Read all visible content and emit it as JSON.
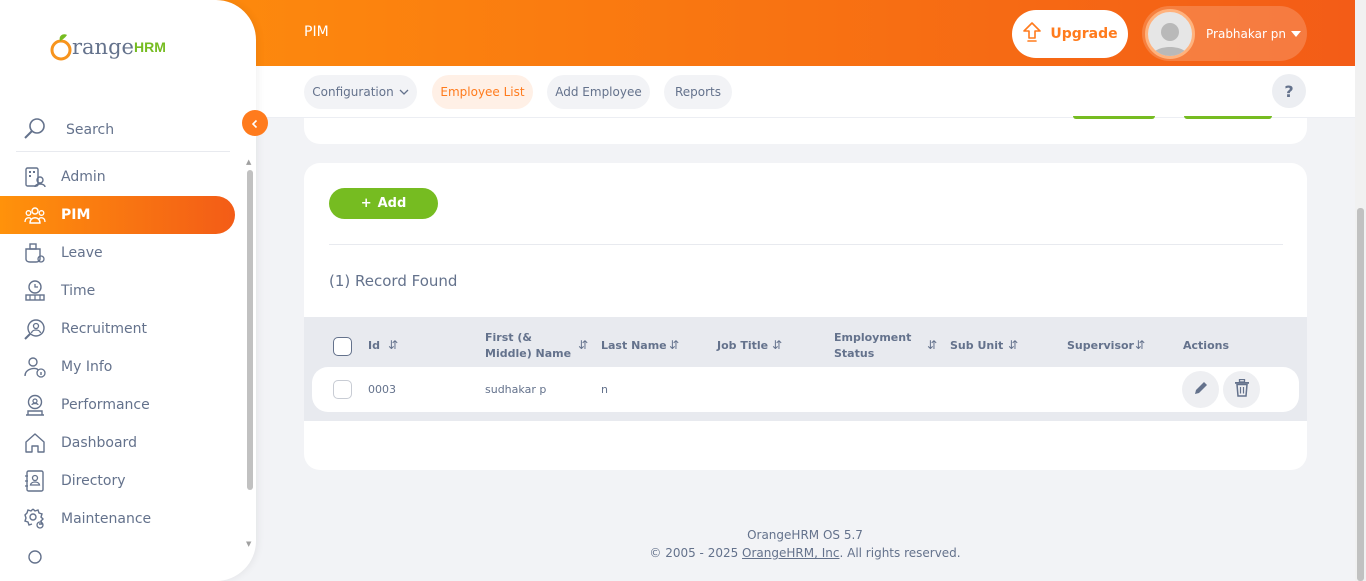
{
  "header": {
    "page_title": "PIM",
    "upgrade_label": "Upgrade",
    "user_name": "Prabhakar pn"
  },
  "subnav": {
    "configuration": "Configuration",
    "employee_list": "Employee List",
    "add_employee": "Add Employee",
    "reports": "Reports",
    "help": "?"
  },
  "sidebar": {
    "logo_text": "range",
    "logo_hrm": "HRM",
    "search_label": "Search",
    "items": [
      {
        "label": "Admin",
        "icon": "admin-icon"
      },
      {
        "label": "PIM",
        "icon": "pim-icon",
        "active": true
      },
      {
        "label": "Leave",
        "icon": "leave-icon"
      },
      {
        "label": "Time",
        "icon": "time-icon"
      },
      {
        "label": "Recruitment",
        "icon": "recruitment-icon"
      },
      {
        "label": "My Info",
        "icon": "my-info-icon"
      },
      {
        "label": "Performance",
        "icon": "performance-icon"
      },
      {
        "label": "Dashboard",
        "icon": "dashboard-icon"
      },
      {
        "label": "Directory",
        "icon": "directory-icon"
      },
      {
        "label": "Maintenance",
        "icon": "maintenance-icon"
      }
    ]
  },
  "main": {
    "add_label": "Add",
    "record_count": "(1) Record Found",
    "columns": {
      "id": "Id",
      "first_name_1": "First (&",
      "first_name_2": "Middle) Name",
      "last_name": "Last Name",
      "job_title": "Job Title",
      "employment_status_1": "Employment",
      "employment_status_2": "Status",
      "sub_unit": "Sub Unit",
      "supervisor": "Supervisor",
      "actions": "Actions"
    },
    "rows": [
      {
        "id": "0003",
        "first_name": "sudhakar p",
        "last_name": "n"
      }
    ]
  },
  "footer": {
    "version": "OrangeHRM OS 5.7",
    "copyright_prefix": "© 2005 - 2025 ",
    "company_link": "OrangeHRM, Inc",
    "copyright_suffix": ". All rights reserved."
  },
  "colors": {
    "brand_orange": "#ff7b1d",
    "brand_green": "#76bc21",
    "text": "#64728c"
  }
}
